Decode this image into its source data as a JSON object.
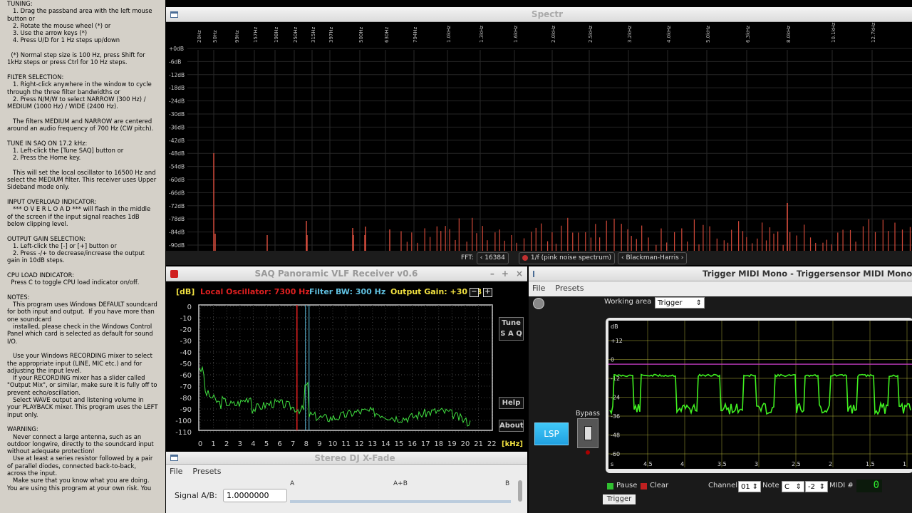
{
  "help_text": [
    "TUNING:",
    "   1. Drag the passband area with the left mouse",
    "button or",
    "   2. Rotate the mouse wheel (*) or",
    "   3. Use the arrow keys (*)",
    "   4. Press U/D for 1 Hz steps up/down",
    "",
    "  (*) Normal step size is 100 Hz, press Shift for",
    "1kHz steps or press Ctrl for 10 Hz steps.",
    "",
    "FILTER SELECTION:",
    "   1. Right-click anywhere in the window to cycle",
    "through the three filter bandwidths or",
    "   2. Press N/M/W to select NARROW (300 Hz) /",
    "MEDIUM (1000 Hz) / WIDE (2400 Hz).",
    "",
    "   The filters MEDIUM and NARROW are centered",
    "around an audio frequency of 700 Hz (CW pitch).",
    "",
    "TUNE IN SAQ ON 17.2 kHz:",
    "   1. Left-click the [Tune SAQ] button or",
    "   2. Press the Home key.",
    "",
    "   This will set the local oscillator to 16500 Hz and",
    "select the MEDIUM filter. This receiver uses Upper",
    "Sideband mode only.",
    "",
    "INPUT OVERLOAD INDICATOR:",
    "   *** O V E R L O A D *** will flash in the middle",
    "of the screen if the input signal reaches 1dB",
    "below clipping level.",
    "",
    "OUTPUT GAIN SELECTION:",
    "   1. Left-click the [-] or [+] button or",
    "   2. Press -/+ to decrease/increase the output",
    "gain in 10dB steps.",
    "",
    "CPU LOAD INDICATOR:",
    "  Press C to toggle CPU load indicator on/off.",
    "",
    "NOTES:",
    "   This program uses Windows DEFAULT soundcard",
    "for both input and output.  If you have more than",
    "one soundcard",
    "   installed, please check in the Windows Control",
    "Panel which card is selected as default for sound",
    "I/O.",
    "",
    "   Use your Windows RECORDING mixer to select",
    "the appropriate input (LINE, MIC etc.) and for",
    "adjusting the input level.",
    "   If your RECORDING mixer has a slider called",
    "\"Output Mix\", or similar, make sure it is fully off to",
    "prevent echo/oscillation.",
    "   Select WAVE output and listening volume in",
    "your PLAYBACK mixer. This program uses the LEFT",
    "input only.",
    "",
    "WARNING:",
    "   Never connect a large antenna, such as an",
    "outdoor longwire, directly to the soundcard input",
    "without adequate protection!",
    "   Use at least a series resistor followed by a pair",
    "of parallel diodes, connected back-to-back,",
    "across the input.",
    "   Make sure that you know what you are doing.",
    "You are using this program at your own risk. You"
  ],
  "spectr": {
    "title": "Spectr",
    "freq_labels": [
      "20Hz",
      "50Hz",
      "99Hz",
      "157Hz",
      "198Hz",
      "250Hz",
      "315Hz",
      "397Hz",
      "500Hz",
      "630Hz",
      "794Hz",
      "1.0kHz",
      "1.3kHz",
      "1.6kHz",
      "2.0kHz",
      "2.5kHz",
      "3.2kHz",
      "4.0kHz",
      "5.0kHz",
      "6.3kHz",
      "8.0kHz",
      "10.1kHz",
      "12.7kHz"
    ],
    "db_labels": [
      "+0dB",
      "-6dB",
      "-12dB",
      "-18dB",
      "-24dB",
      "-30dB",
      "-36dB",
      "-42dB",
      "-48dB",
      "-54dB",
      "-60dB",
      "-66dB",
      "-72dB",
      "-78dB",
      "-84dB",
      "-90dB"
    ],
    "fft_label": "FFT:",
    "fft_size": "16384",
    "mode": "1/f (pink noise spectrum)",
    "window": "Blackman-Harris"
  },
  "saq": {
    "title": "SAQ Panoramic VLF Receiver v0.6",
    "db_unit": "[dB]",
    "lo_label": "Local Oscillator: 7300 Hz",
    "bw_label": "Filter BW: 300 Hz",
    "gain_label": "Output Gain: +30 dB",
    "minus": "−",
    "plus": "+",
    "y_labels": [
      "0",
      "-10",
      "-20",
      "-30",
      "-40",
      "-50",
      "-60",
      "-70",
      "-80",
      "-90",
      "-100",
      "-110"
    ],
    "x_labels": [
      "0",
      "1",
      "2",
      "3",
      "4",
      "5",
      "6",
      "7",
      "8",
      "9",
      "10",
      "11",
      "12",
      "13",
      "14",
      "15",
      "16",
      "17",
      "18",
      "19",
      "20",
      "21",
      "22"
    ],
    "x_unit": "[kHz]",
    "tune_line1": "Tune",
    "tune_line2": "S A Q",
    "help": "Help",
    "about": "About",
    "colors": {
      "lo": "#e02020",
      "bw": "#60c0e0",
      "gain": "#f0e040",
      "trace": "#40e040"
    }
  },
  "djx": {
    "title": "Stereo DJ X-Fade",
    "menu_file": "File",
    "menu_presets": "Presets",
    "signal_label": "Signal A/B:",
    "signal_value": "1.0000000",
    "mark_a": "A",
    "mark_ab": "A+B",
    "mark_b": "B"
  },
  "trig": {
    "title": "Trigger MIDI Mono - Triggersensor MIDI Mono",
    "menu_file": "File",
    "menu_presets": "Presets",
    "working_area_label": "Working area",
    "working_area_value": "Trigger",
    "lsp": "LSP",
    "bypass": "Bypass",
    "db_unit": "dB",
    "y_labels": [
      "+12",
      "0",
      "-12",
      "-24",
      "-36",
      "-48",
      "-60"
    ],
    "x_labels": [
      "s",
      "4.5",
      "4",
      "3.5",
      "3",
      "2.5",
      "2",
      "1.5",
      "1"
    ],
    "pause": "Pause",
    "clear": "Clear",
    "channel_label": "Channel",
    "channel_value": "01",
    "note_label": "Note",
    "note_value": "C",
    "octave_value": "-2",
    "midi_label": "MIDI #",
    "midi_value": "0",
    "tab": "Trigger",
    "colors": {
      "trace": "#40f020",
      "threshold": "#d040d0",
      "grid": "#c8c840"
    }
  }
}
